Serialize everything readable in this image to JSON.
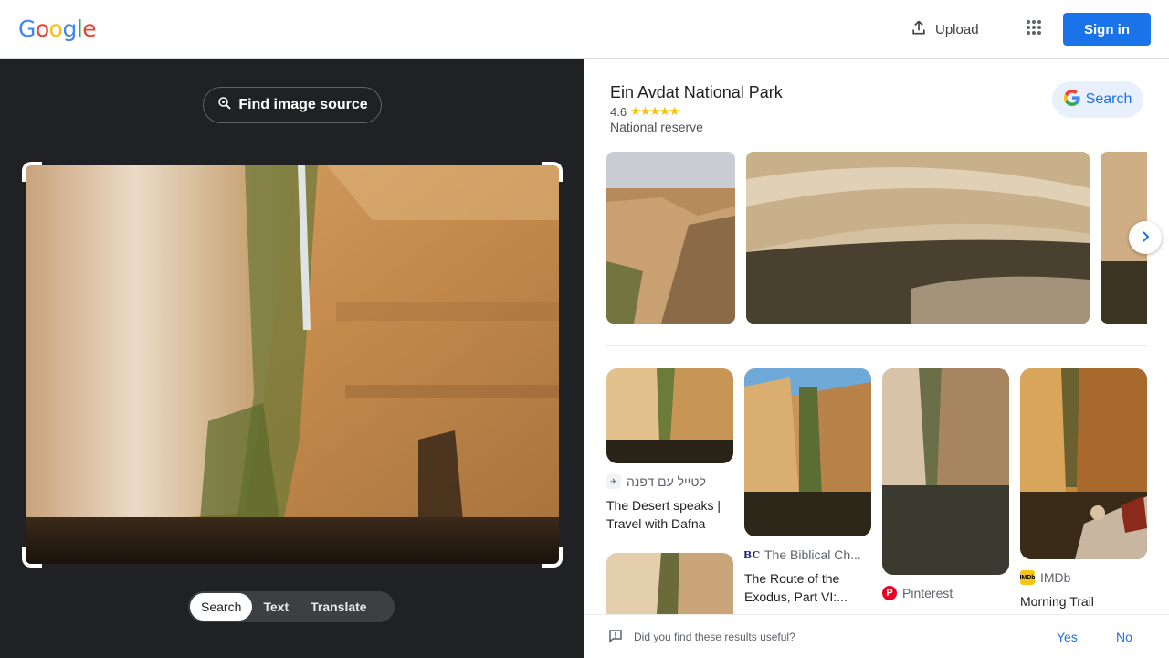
{
  "header": {
    "logo": [
      "G",
      "o",
      "o",
      "g",
      "l",
      "e"
    ],
    "upload_label": "Upload",
    "signin_label": "Sign in"
  },
  "left": {
    "find_source_label": "Find image source",
    "tabs": [
      {
        "label": "Search",
        "active": true
      },
      {
        "label": "Text",
        "active": false
      },
      {
        "label": "Translate",
        "active": false
      }
    ]
  },
  "knowledge_panel": {
    "title": "Ein Avdat National Park",
    "rating": "4.6",
    "stars": "★★★★★",
    "type": "National reserve",
    "search_label": "Search"
  },
  "results": [
    {
      "source": "לטייל עם דפנה",
      "title": "The Desert speaks | Travel with Dafna"
    },
    {
      "source": "The Biblical Ch...",
      "title": "The Route of the Exodus, Part VI:..."
    },
    {
      "source": "Pinterest",
      "title": ""
    },
    {
      "source": "IMDb",
      "title": "Morning Trail"
    }
  ],
  "feedback": {
    "question": "Did you find these results useful?",
    "yes": "Yes",
    "no": "No"
  },
  "colors": {
    "accent": "#1a73e8",
    "dark_bg": "#202124",
    "star": "#fbbc04"
  }
}
